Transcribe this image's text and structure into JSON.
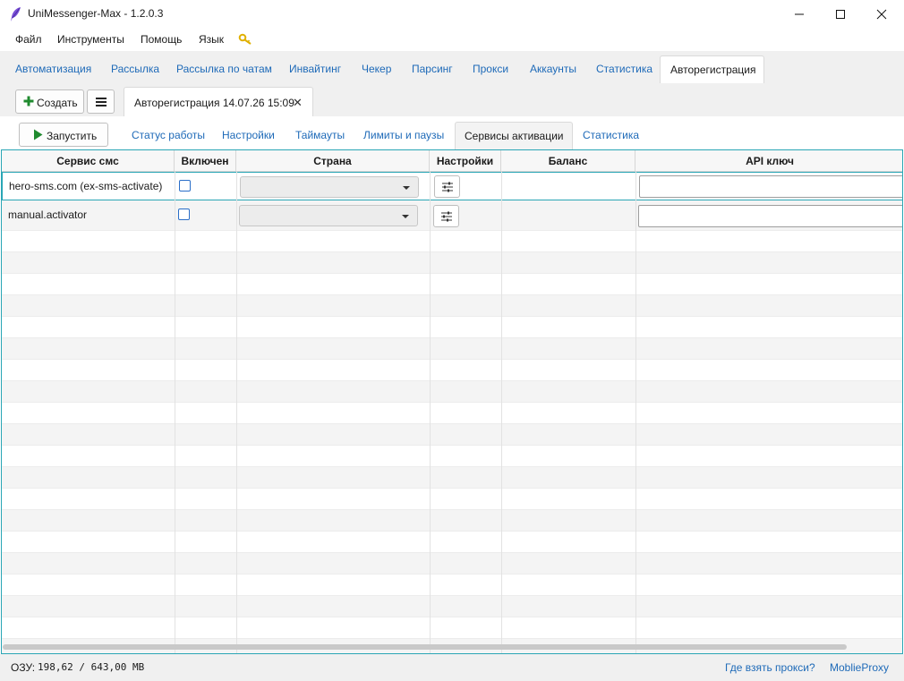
{
  "window": {
    "title": "UniMessenger-Max - 1.2.0.3"
  },
  "menu": {
    "file": "Файл",
    "tools": "Инструменты",
    "help": "Помощь",
    "language": "Язык"
  },
  "main_tabs": [
    {
      "label": "Автоматизация"
    },
    {
      "label": "Рассылка"
    },
    {
      "label": "Рассылка по чатам"
    },
    {
      "label": "Инвайтинг"
    },
    {
      "label": "Чекер"
    },
    {
      "label": "Парсинг"
    },
    {
      "label": "Прокси"
    },
    {
      "label": "Аккаунты"
    },
    {
      "label": "Статистика"
    },
    {
      "label": "Авторегистрация",
      "active": true
    }
  ],
  "toolbar": {
    "create_label": "Создать",
    "document_tab": "Авторегистрация 14.07.26 15:09"
  },
  "run_button": {
    "label": "Запустить"
  },
  "sub_tabs": [
    {
      "label": "Статус работы"
    },
    {
      "label": "Настройки"
    },
    {
      "label": "Таймауты"
    },
    {
      "label": "Лимиты и паузы"
    },
    {
      "label": "Сервисы активации",
      "active": true
    },
    {
      "label": "Статистика"
    }
  ],
  "table": {
    "columns": [
      "Сервис смс",
      "Включен",
      "Страна",
      "Настройки",
      "Баланс",
      "API ключ"
    ],
    "rows": [
      {
        "service": "hero-sms.com (ex-sms-activate)",
        "enabled": false,
        "country": "",
        "balance": "",
        "api_key": ""
      },
      {
        "service": "manual.activator",
        "enabled": false,
        "country": "",
        "balance": "",
        "api_key": ""
      }
    ]
  },
  "status_bar": {
    "ram_label": "ОЗУ:",
    "ram_value": "198,62 / 643,00 MB",
    "proxy_link": "Где взять прокси?",
    "mobile_proxy_link": "MoblieProxy"
  },
  "colors": {
    "accent_link": "#1e6ab8",
    "grid_border": "#2aa6b5",
    "checkbox": "#2a6ec8",
    "create_plus": "#1f8a2e",
    "run_play": "#1f8a2e"
  },
  "icons": {
    "app": "feather-icon",
    "key": "key-icon",
    "create": "plus-icon",
    "menu": "hamburger-icon",
    "run": "play-icon",
    "settings": "sliders-icon",
    "close_tab": "close-icon"
  }
}
